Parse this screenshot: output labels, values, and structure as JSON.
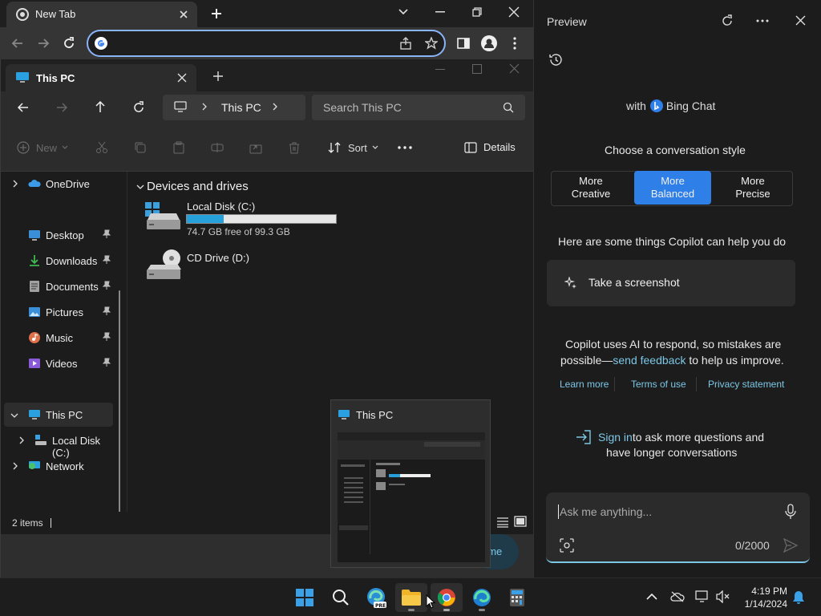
{
  "chrome": {
    "tab_title": "New Tab",
    "omnibox_value": ""
  },
  "explorer": {
    "tab_title": "This PC",
    "breadcrumb": "This PC",
    "search_placeholder": "Search This PC",
    "cmd": {
      "new_label": "New",
      "sort_label": "Sort",
      "details_label": "Details"
    },
    "sidebar": {
      "onedrive": "OneDrive",
      "quick": [
        {
          "label": "Desktop",
          "icon": "desktop-icon",
          "color": "#3a8fd8"
        },
        {
          "label": "Downloads",
          "icon": "downloads-icon",
          "color": "#3fb950"
        },
        {
          "label": "Documents",
          "icon": "documents-icon",
          "color": "#a0a0a0"
        },
        {
          "label": "Pictures",
          "icon": "pictures-icon",
          "color": "#3a8fd8"
        },
        {
          "label": "Music",
          "icon": "music-icon",
          "color": "#e0704a"
        },
        {
          "label": "Videos",
          "icon": "videos-icon",
          "color": "#8a5ad8"
        }
      ],
      "this_pc": "This PC",
      "local_disk": "Local Disk (C:)",
      "network": "Network"
    },
    "main": {
      "group_header": "Devices and drives",
      "drives": [
        {
          "name": "Local Disk (C:)",
          "free_text": "74.7 GB free of 99.3 GB",
          "used_fraction": 0.248
        },
        {
          "name": "CD Drive (D:)"
        }
      ]
    },
    "status": "2 items"
  },
  "thumbnail": {
    "title": "This PC"
  },
  "copilot": {
    "header_title": "Preview",
    "with_label": "with",
    "bing_label": "Bing Chat",
    "style_heading": "Choose a conversation style",
    "styles": [
      {
        "line1": "More",
        "line2": "Creative"
      },
      {
        "line1": "More",
        "line2": "Balanced"
      },
      {
        "line1": "More",
        "line2": "Precise"
      }
    ],
    "help_heading": "Here are some things Copilot can help you do",
    "suggestion": "Take a screenshot",
    "disclaimer_1": "Copilot uses AI to respond, so mistakes are",
    "disclaimer_2a": "possible—",
    "disclaimer_link": "send feedback",
    "disclaimer_2b": " to help us improve.",
    "links": [
      "Learn more",
      "Terms of use",
      "Privacy statement"
    ],
    "signin_link": "Sign in",
    "signin_rest": " to ask more questions and",
    "signin_line2": "have longer conversations",
    "input_placeholder": "Ask me anything...",
    "char_count": "0/2000",
    "partial_button_text": "ome"
  },
  "taskbar": {
    "time": "4:19 PM",
    "date": "1/14/2024"
  },
  "colors": {
    "accent": "#0078d4",
    "balanced": "#2f7fe8",
    "link": "#7cc7e6",
    "disk_bar": "#26a0da"
  }
}
